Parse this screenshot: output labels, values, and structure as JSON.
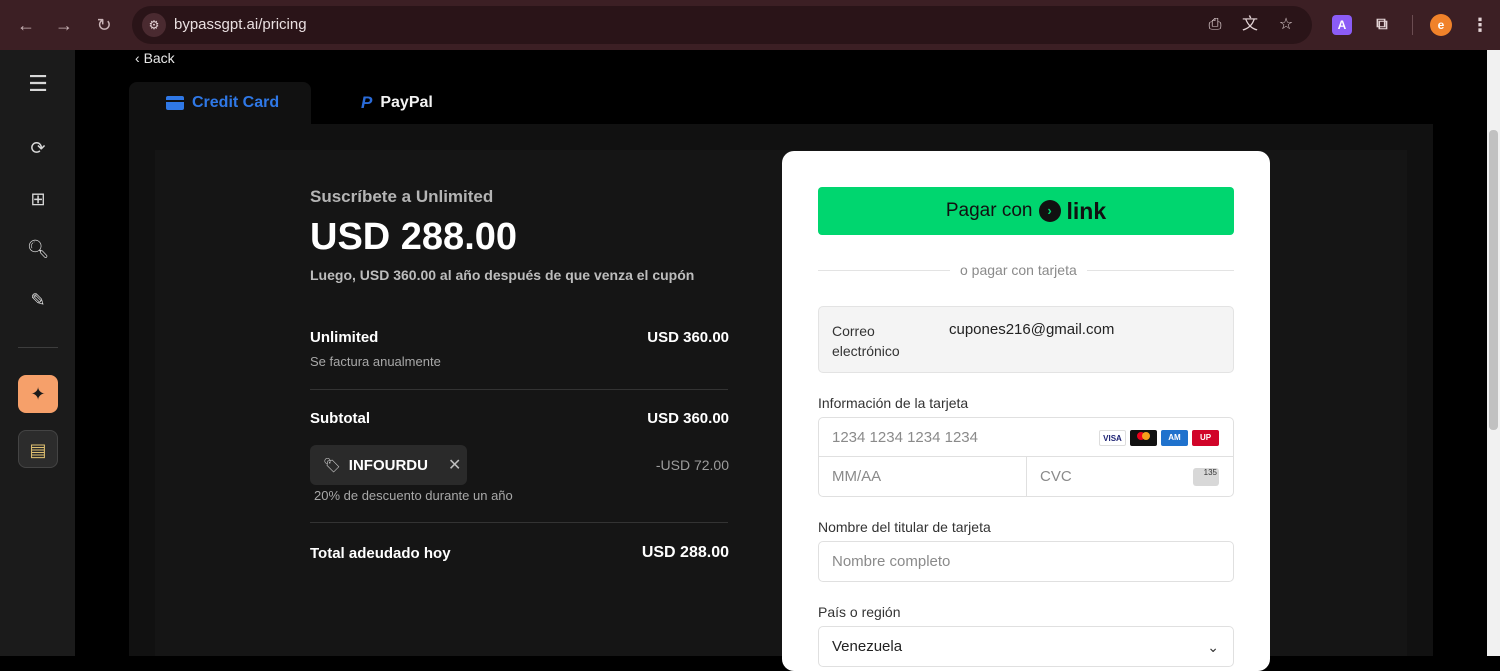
{
  "browser": {
    "url": "bypassgpt.ai/pricing",
    "icons": [
      "back-arrow",
      "forward-arrow",
      "reload",
      "site-info",
      "install-app",
      "translate",
      "bookmark-star",
      "extension-a",
      "extensions-puzzle",
      "profile-avatar",
      "menu-dots"
    ],
    "extension_letter": "A",
    "profile_letter": "e"
  },
  "sidebar": {
    "icons": [
      "hamburger-menu",
      "refresh-circle",
      "plus-square",
      "doc-search",
      "edit-note",
      "ai-sparkle",
      "notepad"
    ],
    "accent_color": "#f6a06a"
  },
  "page": {
    "back_label": "Back",
    "tabs": [
      {
        "label": "Credit Card",
        "active": true
      },
      {
        "label": "PayPal",
        "active": false
      }
    ]
  },
  "summary": {
    "subscribe_title": "Suscríbete a Unlimited",
    "amount": "USD 288.00",
    "after_note": "Luego, USD 360.00 al año después de que venza el cupón",
    "plan_name": "Unlimited",
    "plan_billing": "Se factura anualmente",
    "plan_price": "USD 360.00",
    "subtotal_label": "Subtotal",
    "subtotal_value": "USD 360.00",
    "coupon_code": "INFOURDU",
    "coupon_discount": "-USD 72.00",
    "coupon_note": "20% de descuento durante un año",
    "total_label": "Total adeudado hoy",
    "total_value": "USD 288.00"
  },
  "payment": {
    "link_button_prefix": "Pagar con",
    "link_word": "link",
    "or_text": "o pagar con tarjeta",
    "email_label": "Correo electrónico",
    "email_value": "cupones216@gmail.com",
    "card_info_label": "Información de la tarjeta",
    "card_number_placeholder": "1234 1234 1234 1234",
    "expiry_placeholder": "MM/AA",
    "cvc_placeholder": "CVC",
    "card_brands": [
      "VISA",
      "mastercard",
      "amex",
      "unionpay"
    ],
    "cardholder_label": "Nombre del titular de tarjeta",
    "cardholder_placeholder": "Nombre completo",
    "country_label": "País o región",
    "country_value": "Venezuela",
    "link_color": "#00d66f"
  }
}
